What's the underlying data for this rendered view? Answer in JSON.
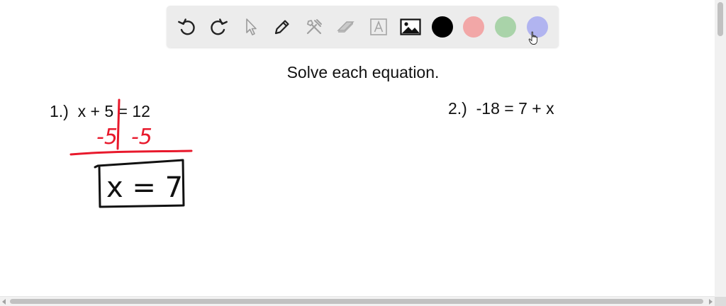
{
  "toolbar": {
    "tools": [
      {
        "name": "undo-icon"
      },
      {
        "name": "redo-icon"
      },
      {
        "name": "select-pointer-icon"
      },
      {
        "name": "pen-icon"
      },
      {
        "name": "tools-icon"
      },
      {
        "name": "eraser-icon"
      },
      {
        "name": "text-box-icon",
        "glyph": "A"
      },
      {
        "name": "image-icon"
      }
    ],
    "colors": [
      "#000000",
      "#f2a7a7",
      "#a9d3a9",
      "#b1b4f0"
    ]
  },
  "worksheet": {
    "heading": "Solve each equation.",
    "problem1": {
      "number": "1.)",
      "equation": "x + 5 = 12"
    },
    "problem2": {
      "number": "2.)",
      "equation": "-18 = 7 + x"
    }
  },
  "ink": {
    "work_text": "-5  -5",
    "answer_text": "x = 7",
    "red": "#e8192c",
    "black": "#111111"
  }
}
